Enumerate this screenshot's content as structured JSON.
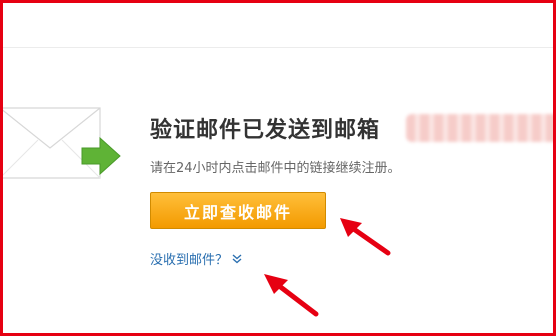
{
  "verification": {
    "headline": "验证邮件已发送到邮箱",
    "instruction": "请在24小时内点击邮件中的链接继续注册。",
    "open_mail_button": "立即查收邮件",
    "not_received_link": "没收到邮件？"
  },
  "icons": {
    "envelope": "envelope-icon",
    "send_arrow": "green-arrow-icon",
    "link_chevron": "double-chevron-down-icon",
    "annotation_arrows": "red-annotation-arrow"
  },
  "colors": {
    "button_gradient_top": "#ffbf3a",
    "button_gradient_bottom": "#f39a00",
    "link": "#2a6fb0",
    "frame_border": "#e60012",
    "annotation": "#e60012"
  }
}
